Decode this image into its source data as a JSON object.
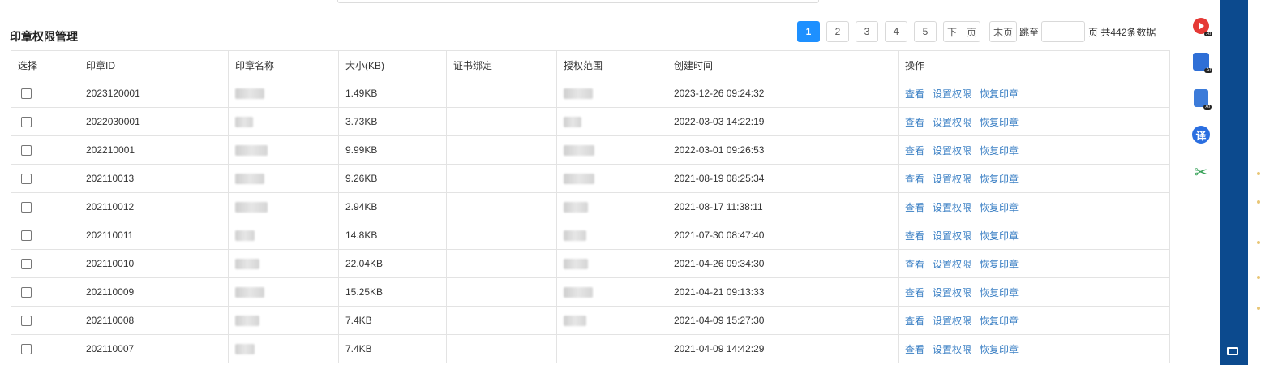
{
  "page_title": "印章权限管理",
  "pagination": {
    "pages": [
      "1",
      "2",
      "3",
      "4",
      "5"
    ],
    "active_page": "1",
    "next_label": "下一页",
    "last_label": "末页",
    "jump_label": "跳至",
    "jump_value": "",
    "total_text": "页 共442条数据"
  },
  "table": {
    "headers": [
      "选择",
      "印章ID",
      "印章名称",
      "大小(KB)",
      "证书绑定",
      "授权范围",
      "创建时间",
      "操作"
    ],
    "actions": [
      "查看",
      "设置权限",
      "恢复印章"
    ],
    "rows": [
      {
        "id": "2023120001",
        "size": "1.49KB",
        "created": "2023-12-26 09:24:32"
      },
      {
        "id": "2022030001",
        "size": "3.73KB",
        "created": "2022-03-03 14:22:19"
      },
      {
        "id": "202210001",
        "size": "9.99KB",
        "created": "2022-03-01 09:26:53"
      },
      {
        "id": "202110013",
        "size": "9.26KB",
        "created": "2021-08-19 08:25:34"
      },
      {
        "id": "202110012",
        "size": "2.94KB",
        "created": "2021-08-17 11:38:11"
      },
      {
        "id": "202110011",
        "size": "14.8KB",
        "created": "2021-07-30 08:47:40"
      },
      {
        "id": "202110010",
        "size": "22.04KB",
        "created": "2021-04-26 09:34:30"
      },
      {
        "id": "202110009",
        "size": "15.25KB",
        "created": "2021-04-21 09:13:33"
      },
      {
        "id": "202110008",
        "size": "7.4KB",
        "created": "2021-04-09 15:27:30"
      },
      {
        "id": "202110007",
        "size": "7.4KB",
        "created": "2021-04-09 14:42:29"
      }
    ]
  },
  "side_tools": [
    {
      "icon": "screen-record-icon"
    },
    {
      "icon": "ai-note-icon"
    },
    {
      "icon": "ai-document-icon"
    },
    {
      "icon": "translate-icon",
      "label": "译"
    },
    {
      "icon": "scissors-icon"
    }
  ],
  "colors": {
    "accent": "#1e90ff",
    "link": "#3a7fc4",
    "sidebar": "#0c4a8e"
  }
}
